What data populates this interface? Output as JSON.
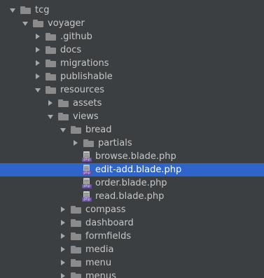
{
  "tree": {
    "nodes": [
      {
        "label": "tcg",
        "type": "folder",
        "depth": 0,
        "state": "open"
      },
      {
        "label": "voyager",
        "type": "folder",
        "depth": 1,
        "state": "open"
      },
      {
        "label": ".github",
        "type": "folder",
        "depth": 2,
        "state": "closed"
      },
      {
        "label": "docs",
        "type": "folder",
        "depth": 2,
        "state": "closed"
      },
      {
        "label": "migrations",
        "type": "folder",
        "depth": 2,
        "state": "closed"
      },
      {
        "label": "publishable",
        "type": "folder",
        "depth": 2,
        "state": "closed"
      },
      {
        "label": "resources",
        "type": "folder",
        "depth": 2,
        "state": "open"
      },
      {
        "label": "assets",
        "type": "folder",
        "depth": 3,
        "state": "closed"
      },
      {
        "label": "views",
        "type": "folder",
        "depth": 3,
        "state": "open"
      },
      {
        "label": "bread",
        "type": "folder",
        "depth": 4,
        "state": "open"
      },
      {
        "label": "partials",
        "type": "folder",
        "depth": 5,
        "state": "closed"
      },
      {
        "label": "browse.blade.php",
        "type": "file",
        "depth": 5,
        "badge": "php"
      },
      {
        "label": "edit-add.blade.php",
        "type": "file",
        "depth": 5,
        "badge": "php",
        "selected": true
      },
      {
        "label": "order.blade.php",
        "type": "file",
        "depth": 5,
        "badge": "php"
      },
      {
        "label": "read.blade.php",
        "type": "file",
        "depth": 5,
        "badge": "php"
      },
      {
        "label": "compass",
        "type": "folder",
        "depth": 4,
        "state": "closed"
      },
      {
        "label": "dashboard",
        "type": "folder",
        "depth": 4,
        "state": "closed"
      },
      {
        "label": "formfields",
        "type": "folder",
        "depth": 4,
        "state": "closed"
      },
      {
        "label": "media",
        "type": "folder",
        "depth": 4,
        "state": "closed"
      },
      {
        "label": "menu",
        "type": "folder",
        "depth": 4,
        "state": "closed"
      },
      {
        "label": "menus",
        "type": "folder",
        "depth": 4,
        "state": "closed"
      }
    ]
  },
  "colors": {
    "background": "#3c3f41",
    "selection": "#2f65ca",
    "text": "#c7c7c7",
    "folder_icon": "#8b8b8b",
    "php_badge": "#6a4fa5"
  },
  "icons": {
    "folder": "folder-icon",
    "file": "php-file-icon",
    "expanded": "chevron-down-icon",
    "collapsed": "chevron-right-icon"
  }
}
